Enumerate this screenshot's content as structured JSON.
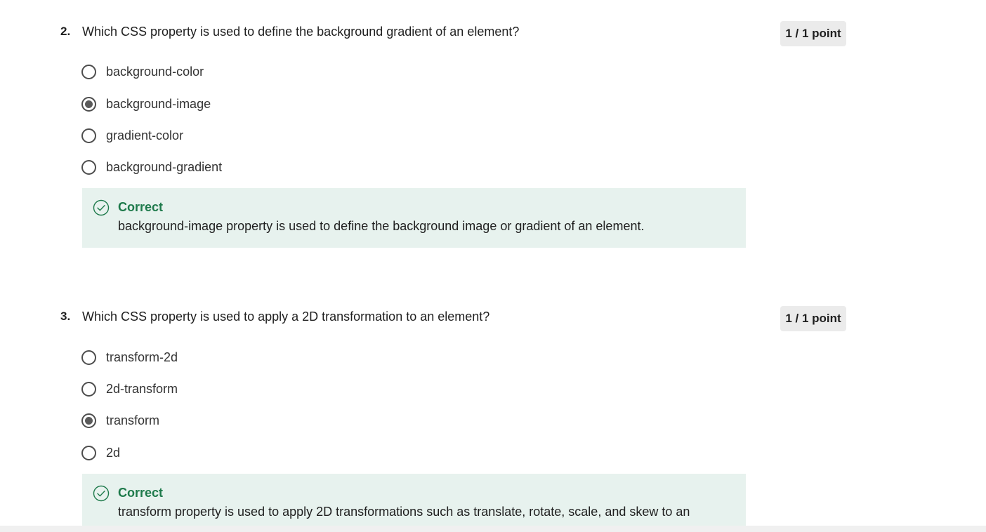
{
  "questions": [
    {
      "number": "2.",
      "text": "Which CSS property is used to define the background gradient of an element?",
      "points": "1 / 1 point",
      "options": [
        {
          "label": "background-color",
          "selected": false
        },
        {
          "label": "background-image",
          "selected": true
        },
        {
          "label": "gradient-color",
          "selected": false
        },
        {
          "label": "background-gradient",
          "selected": false
        }
      ],
      "feedback": {
        "status": "Correct",
        "icon": "check-circle-icon",
        "explanation": "background-image property is used to define the background image or gradient of an element."
      }
    },
    {
      "number": "3.",
      "text": "Which CSS property is used to apply a 2D transformation to an element?",
      "points": "1 / 1 point",
      "options": [
        {
          "label": "transform-2d",
          "selected": false
        },
        {
          "label": "2d-transform",
          "selected": false
        },
        {
          "label": "transform",
          "selected": true
        },
        {
          "label": "2d",
          "selected": false
        }
      ],
      "feedback": {
        "status": "Correct",
        "icon": "check-circle-icon",
        "explanation": "transform property is used to apply 2D transformations such as translate, rotate, scale, and skew to an"
      }
    }
  ],
  "colors": {
    "correct_text": "#1e7a4b",
    "feedback_bg": "#e7f2ee",
    "badge_bg": "#ebebeb",
    "radio_border": "#4d4d4d"
  }
}
